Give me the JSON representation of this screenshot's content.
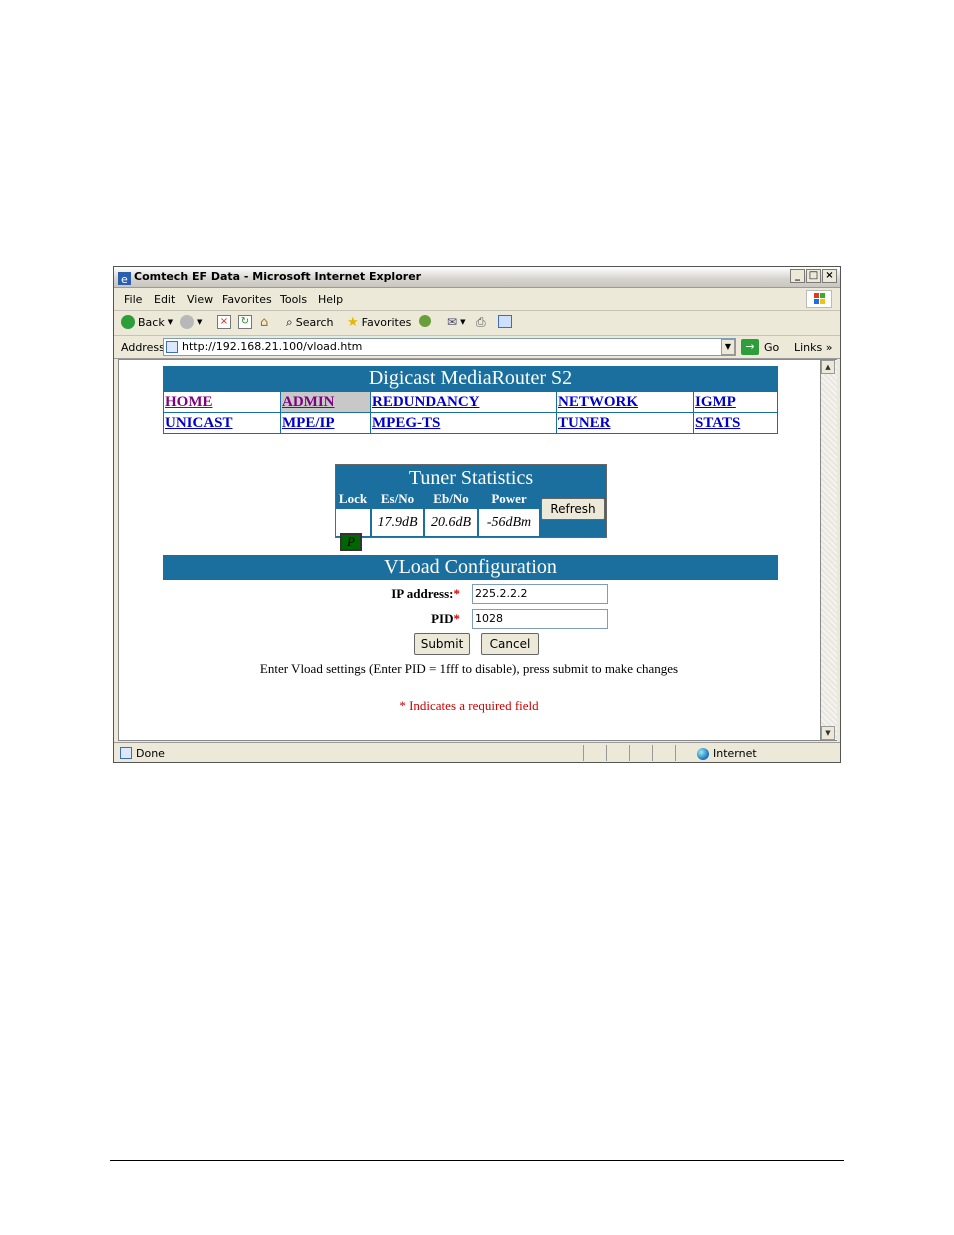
{
  "window": {
    "title": "Comtech EF Data - Microsoft Internet Explorer",
    "controls": [
      "_",
      "□",
      "×"
    ]
  },
  "menu": {
    "items": [
      "File",
      "Edit",
      "View",
      "Favorites",
      "Tools",
      "Help"
    ]
  },
  "toolbar": {
    "back_label": "Back",
    "search_label": "Search",
    "favorites_label": "Favorites"
  },
  "address": {
    "label": "Address",
    "url": "http://192.168.21.100/vload.htm",
    "go_label": "Go",
    "links_label": "Links"
  },
  "page": {
    "header": "Digicast MediaRouter S2",
    "nav": [
      [
        "HOME",
        "ADMIN",
        "REDUNDANCY",
        "NETWORK",
        "IGMP"
      ],
      [
        "UNICAST",
        "MPE/IP",
        "MPEG-TS",
        "TUNER",
        "STATS"
      ]
    ],
    "tuner": {
      "title": "Tuner Statistics",
      "columns": [
        "Lock",
        "Es/No",
        "Eb/No",
        "Power"
      ],
      "lock_value": "P",
      "esno": "17.9dB",
      "ebno": "20.6dB",
      "power": "-56dBm",
      "refresh_label": "Refresh"
    },
    "vload": {
      "title": "VLoad Configuration",
      "ip_label": "IP address:",
      "ip_value": "225.2.2.2",
      "pid_label": "PID",
      "pid_value": "1028",
      "required_mark": "*",
      "submit_label": "Submit",
      "cancel_label": "Cancel",
      "note": "Enter Vload settings (Enter PID = 1fff to disable), press submit to make changes",
      "required_note": "* Indicates a required field"
    }
  },
  "status": {
    "text": "Done",
    "zone": "Internet"
  },
  "colors": {
    "header_bg": "#1a6f9e",
    "link": "#0000cc",
    "visited_link": "#800080",
    "required": "#cc0000",
    "lock_green": "#006600"
  }
}
